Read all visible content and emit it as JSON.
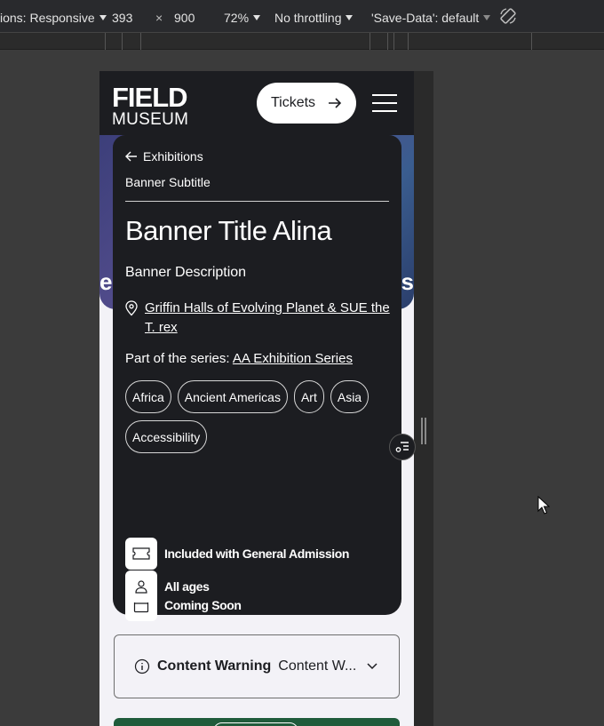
{
  "devtools": {
    "dimensions_label": "ions: Responsive",
    "width": "393",
    "times": "×",
    "height": "900",
    "zoom": "72%",
    "throttling": "No throttling",
    "save_data": "'Save-Data': default"
  },
  "header": {
    "logo_line1": "FIELD",
    "logo_line2": "MUSEUM",
    "tickets_label": "Tickets"
  },
  "hero": {
    "left_fragment": "e",
    "right_fragment": "s"
  },
  "banner": {
    "back_label": "Exhibitions",
    "subtitle": "Banner Subtitle",
    "title": "Banner Title Alina",
    "description": "Banner Description",
    "location": "Griffin Halls of Evolving Planet & SUE the T. rex",
    "series_prefix": "Part of the series:",
    "series_link": "AA Exhibition Series",
    "tags": [
      "Africa",
      "Ancient Americas",
      "Art",
      "Asia",
      "Accessibility"
    ],
    "admission": "Included with General Admission",
    "status": "Coming Soon",
    "audience": "All ages"
  },
  "content_warning": {
    "label": "Content Warning",
    "value": "Content W..."
  },
  "colors": {
    "dark": "#1c1d21",
    "page_bg": "#f3f2f7",
    "green": "#1f5b3b"
  }
}
